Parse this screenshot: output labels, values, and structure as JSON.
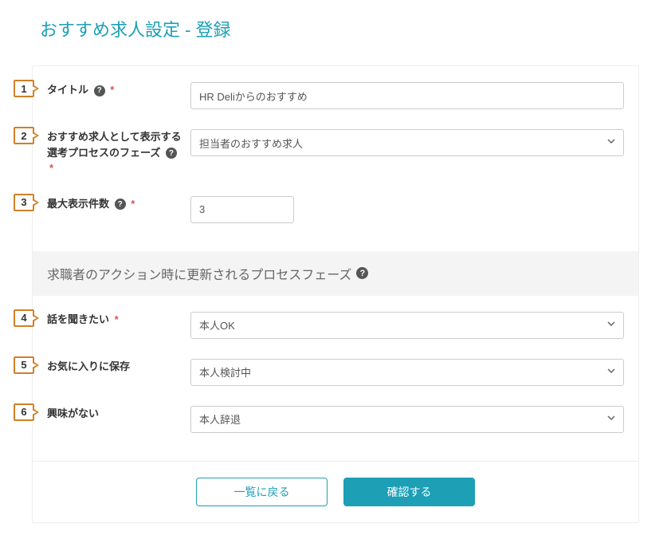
{
  "page_title": "おすすめ求人設定 - 登録",
  "badges": [
    "1",
    "2",
    "3",
    "4",
    "5",
    "6"
  ],
  "fields": {
    "title": {
      "label": "タイトル",
      "value": "HR Deliからのおすすめ",
      "required": true,
      "help": true
    },
    "phase": {
      "label": "おすすめ求人として表示する選考プロセスのフェーズ",
      "value": "担当者のおすすめ求人",
      "required": true,
      "help": true
    },
    "max_count": {
      "label": "最大表示件数",
      "value": "3",
      "required": true,
      "help": true
    }
  },
  "section_header": "求職者のアクション時に更新されるプロセスフェーズ",
  "action_fields": {
    "want_to_hear": {
      "label": "話を聞きたい",
      "value": "本人OK",
      "required": true
    },
    "favorite": {
      "label": "お気に入りに保存",
      "value": "本人検討中",
      "required": false
    },
    "not_interested": {
      "label": "興味がない",
      "value": "本人辞退",
      "required": false
    }
  },
  "buttons": {
    "back": "一覧に戻る",
    "confirm": "確認する"
  },
  "help_glyph": "?"
}
